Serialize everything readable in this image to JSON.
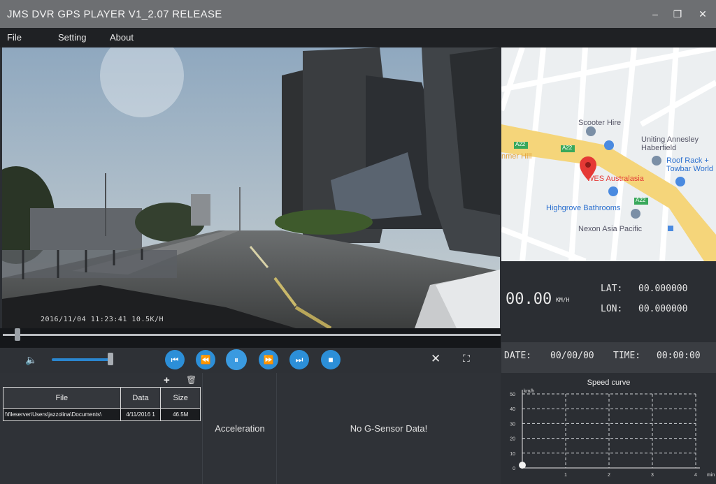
{
  "window": {
    "title": "JMS DVR GPS PLAYER V1_2.07 RELEASE",
    "minimize_glyph": "–",
    "maximize_glyph": "❐",
    "close_glyph": "✕"
  },
  "menu": {
    "file": "File",
    "setting": "Setting",
    "about": "About"
  },
  "video": {
    "timestamp_overlay": "2016/11/04 11:23:41 10.5K/H"
  },
  "controls": {
    "volume_icon": "speaker-icon",
    "prev_glyph": "⏮",
    "rewind_glyph": "⏪",
    "pause_glyph": "⏸",
    "forward_glyph": "⏩",
    "next_glyph": "⏭",
    "stop_glyph": "■",
    "close_glyph": "✕",
    "fullscreen_glyph": "⛶",
    "volume_level": 0.95,
    "seek_position": 0.03
  },
  "file_panel": {
    "add_glyph": "+",
    "delete_glyph": "🗑",
    "headers": {
      "file": "File",
      "data": "Data",
      "size": "Size"
    },
    "rows": [
      {
        "file": "\\\\fileserver\\Users\\jazzolina\\Documents\\",
        "data": "4/11/2016 1",
        "size": "46.5M"
      }
    ]
  },
  "sensor": {
    "acceleration_label": "Acceleration",
    "gsensor_message": "No G-Sensor Data!"
  },
  "map": {
    "street_labels": [
      "Scooter Hire",
      "Uniting Annesley Haberfield",
      "Roof Rack + Towbar World",
      "WES Australasia",
      "Highgrove Bathrooms",
      "Nexon Asia Pacific",
      "nmer Hill",
      "A22",
      "A22",
      "A22"
    ],
    "marker_label": "WES Australasia"
  },
  "gps": {
    "speed": "00.00",
    "speed_unit": "KM/H",
    "lat_label": "LAT:",
    "lat_value": "00.000000",
    "lon_label": "LON:",
    "lon_value": "00.000000",
    "date_label": "DATE:",
    "date_value": "00/00/00",
    "time_label": "TIME:",
    "time_value": "00:00:00"
  },
  "colors": {
    "accent": "#2c8fd8",
    "title_bar": "#6d6f72",
    "panel": "#2b2e33",
    "map_road": "#f5d57a",
    "marker": "#e53935"
  },
  "chart_data": {
    "type": "line",
    "title": "Speed curve",
    "ylabel": "km/h",
    "xlabel": "min",
    "ylim": [
      0,
      50
    ],
    "xlim": [
      0,
      4
    ],
    "y_ticks": [
      "0",
      "10",
      "20",
      "30",
      "40",
      "50"
    ],
    "x_ticks": [
      "1",
      "2",
      "3",
      "4"
    ],
    "grid": true,
    "series": [
      {
        "values": [
          0
        ]
      }
    ]
  }
}
